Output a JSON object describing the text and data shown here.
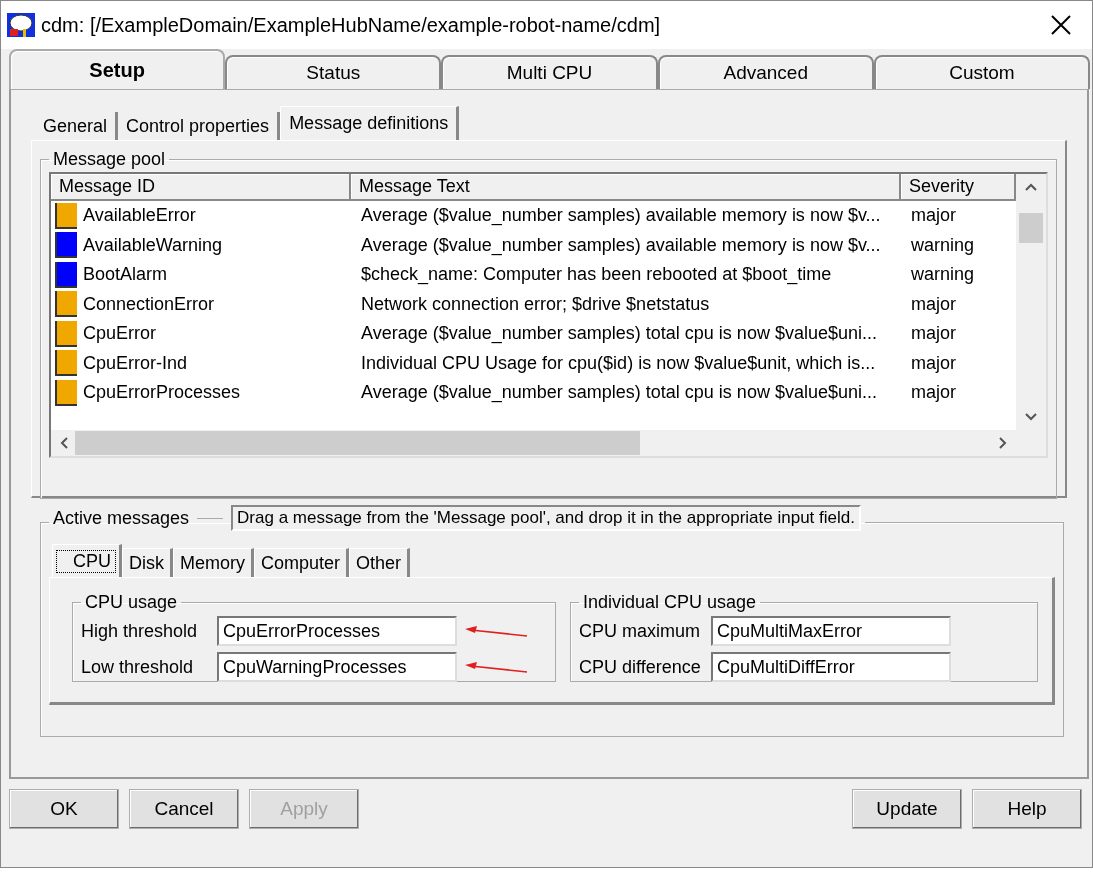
{
  "window": {
    "title": "cdm: [/ExampleDomain/ExampleHubName/example-robot-name/cdm]"
  },
  "tabs": [
    {
      "label": "Setup",
      "selected": true
    },
    {
      "label": "Status",
      "selected": false
    },
    {
      "label": "Multi CPU",
      "selected": false
    },
    {
      "label": "Advanced",
      "selected": false
    },
    {
      "label": "Custom",
      "selected": false
    }
  ],
  "subtabs": [
    {
      "label": "General",
      "selected": false
    },
    {
      "label": "Control properties",
      "selected": false
    },
    {
      "label": "Message definitions",
      "selected": true
    }
  ],
  "message_pool": {
    "title": "Message pool",
    "columns": [
      "Message ID",
      "Message Text",
      "Severity"
    ],
    "rows": [
      {
        "id": "AvailableError",
        "text": "Average ($value_number samples) available memory is now $v...",
        "severity": "major",
        "color": "#f0a800"
      },
      {
        "id": "AvailableWarning",
        "text": "Average ($value_number samples) available memory is now $v...",
        "severity": "warning",
        "color": "#0000ff"
      },
      {
        "id": "BootAlarm",
        "text": "$check_name: Computer has been rebooted at $boot_time",
        "severity": "warning",
        "color": "#0000ff"
      },
      {
        "id": "ConnectionError",
        "text": "Network connection error; $drive $netstatus",
        "severity": "major",
        "color": "#f0a800"
      },
      {
        "id": "CpuError",
        "text": "Average ($value_number samples) total cpu is now $value$uni...",
        "severity": "major",
        "color": "#f0a800"
      },
      {
        "id": "CpuError-Ind",
        "text": "Individual CPU Usage for cpu($id) is now $value$unit, which is...",
        "severity": "major",
        "color": "#f0a800"
      },
      {
        "id": "CpuErrorProcesses",
        "text": "Average ($value_number samples) total cpu is now $value$uni...",
        "severity": "major",
        "color": "#f0a800"
      }
    ]
  },
  "active_messages": {
    "title": "Active messages",
    "hint": "Drag a message from the 'Message pool', and drop it in the appropriate input field.",
    "tabs": [
      {
        "label": "CPU",
        "selected": true
      },
      {
        "label": "Disk",
        "selected": false
      },
      {
        "label": "Memory",
        "selected": false
      },
      {
        "label": "Computer",
        "selected": false
      },
      {
        "label": "Other",
        "selected": false
      }
    ],
    "groups": [
      {
        "title": "CPU usage",
        "fields": [
          {
            "label": "High threshold",
            "value": "CpuErrorProcesses",
            "annotated": true
          },
          {
            "label": "Low threshold",
            "value": "CpuWarningProcesses",
            "annotated": true
          }
        ]
      },
      {
        "title": "Individual CPU usage",
        "fields": [
          {
            "label": "CPU maximum",
            "value": "CpuMultiMaxError",
            "annotated": false
          },
          {
            "label": "CPU difference",
            "value": "CpuMultiDiffError",
            "annotated": false
          }
        ]
      }
    ]
  },
  "buttons": {
    "left": [
      {
        "label": "OK",
        "disabled": false
      },
      {
        "label": "Cancel",
        "disabled": false
      },
      {
        "label": "Apply",
        "disabled": true
      }
    ],
    "right": [
      {
        "label": "Update",
        "disabled": false
      },
      {
        "label": "Help",
        "disabled": false
      }
    ]
  }
}
